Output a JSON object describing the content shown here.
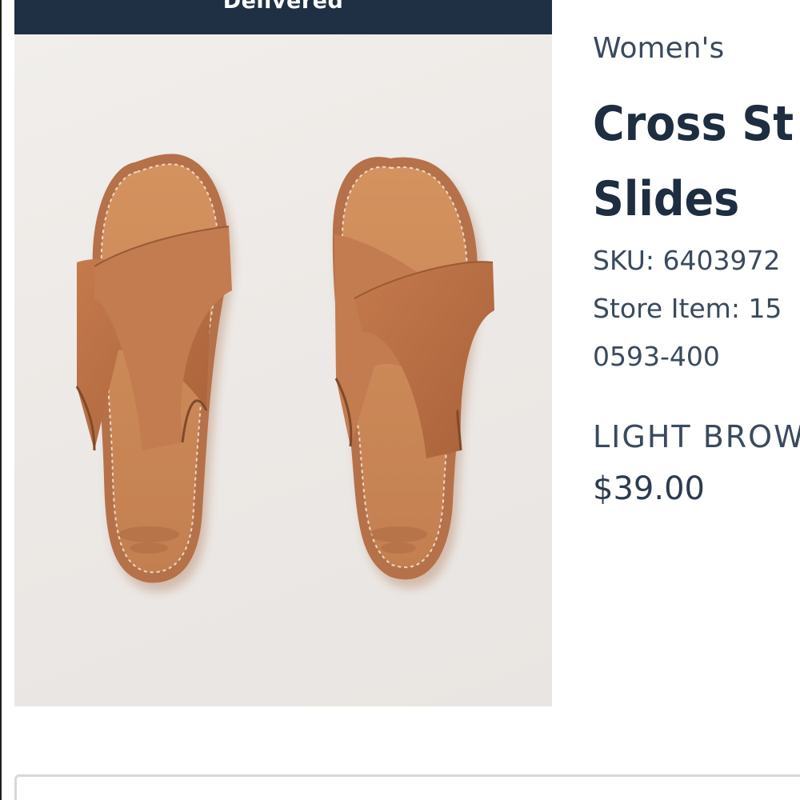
{
  "banner": {
    "status": "Delivered"
  },
  "product": {
    "category": "Women's",
    "title_line1": "Cross St",
    "title_line2": "Slides",
    "sku": "SKU: 6403972",
    "store_item_line1": "Store Item: 15",
    "store_item_line2": "0593-400",
    "color": "LIGHT BROW",
    "price": "$39.00"
  },
  "image": {
    "description_icon": "sandal-product-photo",
    "colors": {
      "leather": "#b86f45",
      "insole": "#cd8a5c",
      "stitch": "#f3e3cf",
      "background": "#eeeae7"
    }
  },
  "colors": {
    "banner_bg": "#1f3045",
    "text_dark": "#1e2d40",
    "text_muted": "#3a4a5e"
  }
}
